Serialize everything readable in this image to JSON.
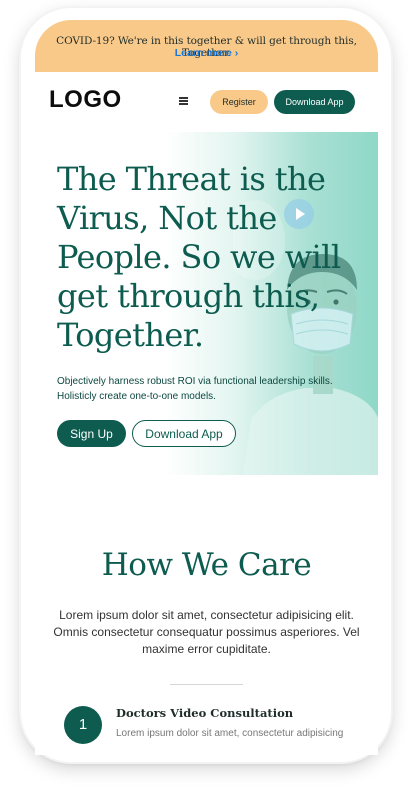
{
  "banner": {
    "text": "COVID-19? We're in this together & will get through this, Together.",
    "link": "Learn more ›"
  },
  "nav": {
    "logo": "LOGO",
    "menu_icon": "hamburger-menu-icon",
    "register_label": "Register",
    "download_label": "Download App"
  },
  "hero": {
    "headline": "The Threat is the Virus, Not the People. So we will get through this, Together.",
    "subtext": "Objectively harness robust ROI via functional leadership skills. Holisticly create one-to-one models.",
    "signup_label": "Sign Up",
    "download_label": "Download App",
    "play_icon": "play-icon"
  },
  "care": {
    "title": "How We Care",
    "description": "Lorem ipsum dolor sit amet, consectetur adipisicing elit. Omnis consectetur consequatur possimus asperiores. Vel maxime error cupiditate."
  },
  "features": [
    {
      "number": "1",
      "title": "Doctors Video Consultation",
      "description": "Lorem ipsum dolor sit amet, consectetur adipisicing"
    }
  ],
  "colors": {
    "primary": "#0d5c4f",
    "accent": "#f9c98a",
    "link": "#1777d6",
    "hero_gradient": "#8fd8c8"
  }
}
